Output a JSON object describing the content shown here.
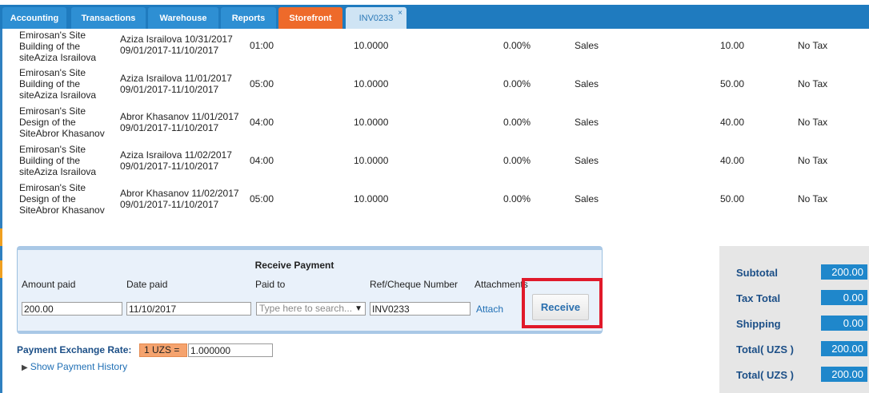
{
  "tabs": [
    {
      "label": "Accounting"
    },
    {
      "label": "Transactions"
    },
    {
      "label": "Warehouse"
    },
    {
      "label": "Reports"
    },
    {
      "label": "Storefront"
    },
    {
      "label": "INV0233",
      "close": "×"
    }
  ],
  "rows": [
    {
      "desc": "Emirosan's Site Building of the siteAziza Israilova",
      "name": "Aziza Israilova 10/31/2017 09/01/2017-11/10/2017",
      "hours": "01:00",
      "rate": "10.0000",
      "discount": "0.00%",
      "account": "Sales",
      "amount": "10.00",
      "tax": "No Tax"
    },
    {
      "desc": "Emirosan's Site Building of the siteAziza Israilova",
      "name": "Aziza Israilova 11/01/2017 09/01/2017-11/10/2017",
      "hours": "05:00",
      "rate": "10.0000",
      "discount": "0.00%",
      "account": "Sales",
      "amount": "50.00",
      "tax": "No Tax"
    },
    {
      "desc": "Emirosan's Site Design of the SiteAbror Khasanov",
      "name": "Abror Khasanov 11/01/2017 09/01/2017-11/10/2017",
      "hours": "04:00",
      "rate": "10.0000",
      "discount": "0.00%",
      "account": "Sales",
      "amount": "40.00",
      "tax": "No Tax"
    },
    {
      "desc": "Emirosan's Site Building of the siteAziza Israilova",
      "name": "Aziza Israilova 11/02/2017 09/01/2017-11/10/2017",
      "hours": "04:00",
      "rate": "10.0000",
      "discount": "0.00%",
      "account": "Sales",
      "amount": "40.00",
      "tax": "No Tax"
    },
    {
      "desc": "Emirosan's Site Design of the SiteAbror Khasanov",
      "name": "Abror Khasanov 11/02/2017 09/01/2017-11/10/2017",
      "hours": "05:00",
      "rate": "10.0000",
      "discount": "0.00%",
      "account": "Sales",
      "amount": "50.00",
      "tax": "No Tax"
    }
  ],
  "payment": {
    "title": "Receive Payment",
    "labels": {
      "amount_paid": "Amount paid",
      "date_paid": "Date paid",
      "paid_to": "Paid to",
      "ref": "Ref/Cheque Number",
      "attachments": "Attachments"
    },
    "amount_paid": "200.00",
    "date_paid": "11/10/2017",
    "paid_to_placeholder": "Type here to search...",
    "ref": "INV0233",
    "attach": "Attach",
    "receive": "Receive"
  },
  "exchange": {
    "label": "Payment Exchange Rate:",
    "badge": "1 UZS =",
    "rate": "1.000000",
    "history": "Show Payment History"
  },
  "totals": [
    {
      "label": "Subtotal",
      "value": "200.00"
    },
    {
      "label": "Tax Total",
      "value": "0.00"
    },
    {
      "label": "Shipping",
      "value": "0.00"
    },
    {
      "label": "Total( UZS )",
      "value": "200.00"
    },
    {
      "label": "Total( UZS )",
      "value": "200.00"
    }
  ],
  "colors": {
    "tab_blue": "#2e8fd3",
    "tab_orange": "#ee6a2a",
    "accent_red": "#e0192a"
  }
}
